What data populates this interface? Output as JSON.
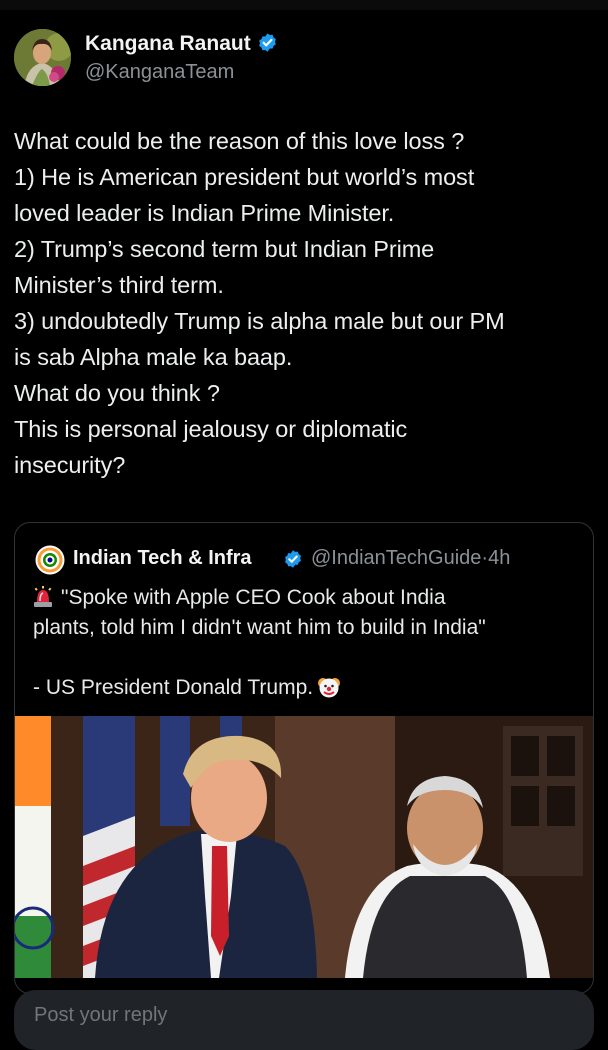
{
  "post": {
    "author_name": "Kangana Ranaut",
    "author_handle": "@KanganaTeam",
    "text_lines": [
      "What could be the reason of this love loss ?",
      "1) He is American president but world’s most",
      "loved leader is Indian Prime Minister.",
      "2) Trump’s second term but Indian Prime",
      "Minister’s third term.",
      "3) undoubtedly Trump is alpha male but our PM",
      "is sab Alpha male ka baap.",
      "What do you think ?",
      "This is personal jealousy or diplomatic",
      "insecurity?"
    ]
  },
  "quote": {
    "author_name": "Indian Tech & Infra",
    "author_handle": "@IndianTechGuide",
    "separator": "·",
    "time": "4h",
    "text_line1": "\"Spoke with Apple CEO Cook about India",
    "text_line2": "plants, told him I didn't want him to build in India\"",
    "text_line3": "- US President Donald Trump.",
    "icons": [
      "siren-icon",
      "clown-face-icon"
    ]
  },
  "reply": {
    "placeholder": "Post your reply"
  },
  "colors": {
    "background": "#000000",
    "verified": "#1d9bf0",
    "secondary_text": "#8b9196",
    "border": "#2f3336"
  }
}
